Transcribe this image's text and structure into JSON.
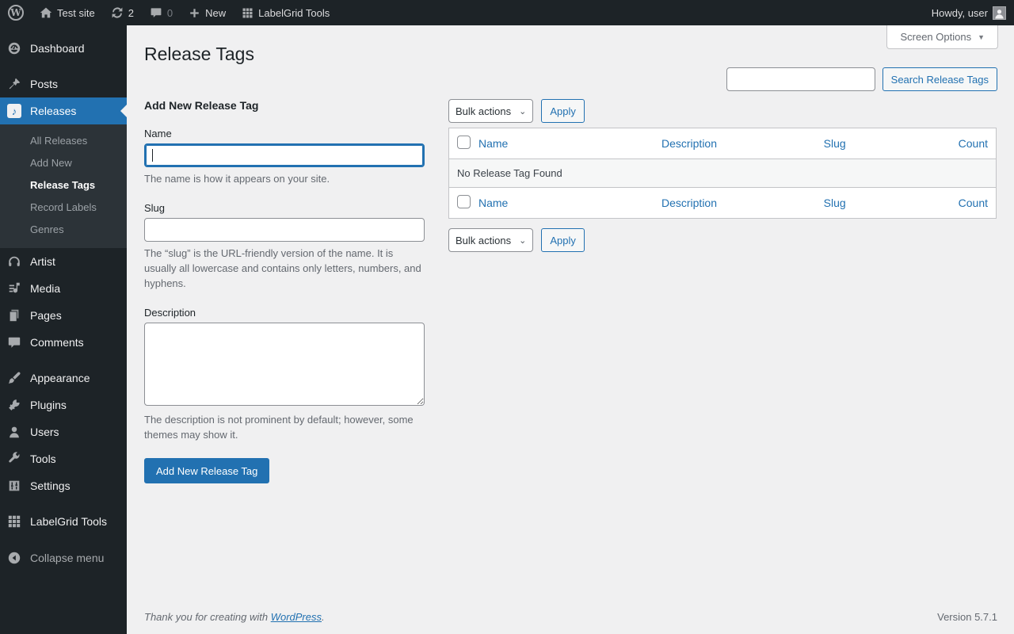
{
  "admin_bar": {
    "site_name": "Test site",
    "updates_count": "2",
    "comments_count": "0",
    "new_label": "New",
    "labelgrid_label": "LabelGrid Tools",
    "howdy": "Howdy, user",
    "wp_logo_letter": "W"
  },
  "sidebar": {
    "items": [
      {
        "label": "Dashboard",
        "icon": "dashboard-icon"
      },
      {
        "label": "Posts",
        "icon": "pin-icon"
      },
      {
        "label": "Releases",
        "icon": "music-note-icon",
        "active": true
      },
      {
        "label": "Artist",
        "icon": "headphones-icon"
      },
      {
        "label": "Media",
        "icon": "media-icon"
      },
      {
        "label": "Pages",
        "icon": "pages-icon"
      },
      {
        "label": "Comments",
        "icon": "comment-icon"
      },
      {
        "label": "Appearance",
        "icon": "brush-icon"
      },
      {
        "label": "Plugins",
        "icon": "plug-icon"
      },
      {
        "label": "Users",
        "icon": "user-icon"
      },
      {
        "label": "Tools",
        "icon": "wrench-icon"
      },
      {
        "label": "Settings",
        "icon": "settings-icon"
      },
      {
        "label": "LabelGrid Tools",
        "icon": "grid-icon"
      },
      {
        "label": "Collapse menu",
        "icon": "collapse-icon"
      }
    ],
    "releases_submenu": [
      "All Releases",
      "Add New",
      "Release Tags",
      "Record Labels",
      "Genres"
    ],
    "releases_note_glyph": "♪"
  },
  "page": {
    "title": "Release Tags",
    "screen_options_label": "Screen Options",
    "screen_options_arrow": "▼",
    "search_button_label": "Search Release Tags",
    "search_value": ""
  },
  "form": {
    "heading": "Add New Release Tag",
    "name_label": "Name",
    "name_value": "",
    "name_help": "The name is how it appears on your site.",
    "slug_label": "Slug",
    "slug_value": "",
    "slug_help": "The “slug” is the URL-friendly version of the name. It is usually all lowercase and contains only letters, numbers, and hyphens.",
    "description_label": "Description",
    "description_value": "",
    "description_help": "The description is not prominent by default; however, some themes may show it.",
    "submit_label": "Add New Release Tag"
  },
  "table": {
    "bulk_actions_label": "Bulk actions",
    "bulk_chevron": "⌄",
    "apply_label": "Apply",
    "columns": [
      "Name",
      "Description",
      "Slug",
      "Count"
    ],
    "empty_message": "No Release Tag Found"
  },
  "footer": {
    "thanks_prefix": "Thank you for creating with ",
    "wordpress_link": "WordPress",
    "thanks_suffix": ".",
    "version": "Version 5.7.1"
  },
  "colors": {
    "accent_blue": "#2271b1",
    "admin_bar_bg": "#1d2327",
    "submenu_bg": "#2c3338",
    "page_bg": "#f0f0f1",
    "border_gray": "#c3c4c7"
  }
}
